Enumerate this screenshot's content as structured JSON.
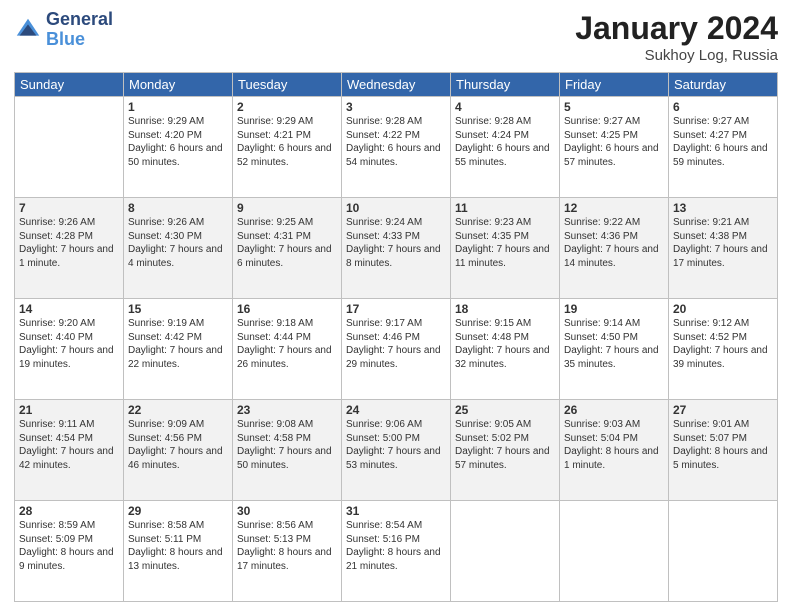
{
  "header": {
    "logo_general": "General",
    "logo_blue": "Blue",
    "month_title": "January 2024",
    "location": "Sukhoy Log, Russia"
  },
  "columns": [
    "Sunday",
    "Monday",
    "Tuesday",
    "Wednesday",
    "Thursday",
    "Friday",
    "Saturday"
  ],
  "weeks": [
    [
      {
        "day": "",
        "sunrise": "",
        "sunset": "",
        "daylight": ""
      },
      {
        "day": "1",
        "sunrise": "Sunrise: 9:29 AM",
        "sunset": "Sunset: 4:20 PM",
        "daylight": "Daylight: 6 hours and 50 minutes."
      },
      {
        "day": "2",
        "sunrise": "Sunrise: 9:29 AM",
        "sunset": "Sunset: 4:21 PM",
        "daylight": "Daylight: 6 hours and 52 minutes."
      },
      {
        "day": "3",
        "sunrise": "Sunrise: 9:28 AM",
        "sunset": "Sunset: 4:22 PM",
        "daylight": "Daylight: 6 hours and 54 minutes."
      },
      {
        "day": "4",
        "sunrise": "Sunrise: 9:28 AM",
        "sunset": "Sunset: 4:24 PM",
        "daylight": "Daylight: 6 hours and 55 minutes."
      },
      {
        "day": "5",
        "sunrise": "Sunrise: 9:27 AM",
        "sunset": "Sunset: 4:25 PM",
        "daylight": "Daylight: 6 hours and 57 minutes."
      },
      {
        "day": "6",
        "sunrise": "Sunrise: 9:27 AM",
        "sunset": "Sunset: 4:27 PM",
        "daylight": "Daylight: 6 hours and 59 minutes."
      }
    ],
    [
      {
        "day": "7",
        "sunrise": "Sunrise: 9:26 AM",
        "sunset": "Sunset: 4:28 PM",
        "daylight": "Daylight: 7 hours and 1 minute."
      },
      {
        "day": "8",
        "sunrise": "Sunrise: 9:26 AM",
        "sunset": "Sunset: 4:30 PM",
        "daylight": "Daylight: 7 hours and 4 minutes."
      },
      {
        "day": "9",
        "sunrise": "Sunrise: 9:25 AM",
        "sunset": "Sunset: 4:31 PM",
        "daylight": "Daylight: 7 hours and 6 minutes."
      },
      {
        "day": "10",
        "sunrise": "Sunrise: 9:24 AM",
        "sunset": "Sunset: 4:33 PM",
        "daylight": "Daylight: 7 hours and 8 minutes."
      },
      {
        "day": "11",
        "sunrise": "Sunrise: 9:23 AM",
        "sunset": "Sunset: 4:35 PM",
        "daylight": "Daylight: 7 hours and 11 minutes."
      },
      {
        "day": "12",
        "sunrise": "Sunrise: 9:22 AM",
        "sunset": "Sunset: 4:36 PM",
        "daylight": "Daylight: 7 hours and 14 minutes."
      },
      {
        "day": "13",
        "sunrise": "Sunrise: 9:21 AM",
        "sunset": "Sunset: 4:38 PM",
        "daylight": "Daylight: 7 hours and 17 minutes."
      }
    ],
    [
      {
        "day": "14",
        "sunrise": "Sunrise: 9:20 AM",
        "sunset": "Sunset: 4:40 PM",
        "daylight": "Daylight: 7 hours and 19 minutes."
      },
      {
        "day": "15",
        "sunrise": "Sunrise: 9:19 AM",
        "sunset": "Sunset: 4:42 PM",
        "daylight": "Daylight: 7 hours and 22 minutes."
      },
      {
        "day": "16",
        "sunrise": "Sunrise: 9:18 AM",
        "sunset": "Sunset: 4:44 PM",
        "daylight": "Daylight: 7 hours and 26 minutes."
      },
      {
        "day": "17",
        "sunrise": "Sunrise: 9:17 AM",
        "sunset": "Sunset: 4:46 PM",
        "daylight": "Daylight: 7 hours and 29 minutes."
      },
      {
        "day": "18",
        "sunrise": "Sunrise: 9:15 AM",
        "sunset": "Sunset: 4:48 PM",
        "daylight": "Daylight: 7 hours and 32 minutes."
      },
      {
        "day": "19",
        "sunrise": "Sunrise: 9:14 AM",
        "sunset": "Sunset: 4:50 PM",
        "daylight": "Daylight: 7 hours and 35 minutes."
      },
      {
        "day": "20",
        "sunrise": "Sunrise: 9:12 AM",
        "sunset": "Sunset: 4:52 PM",
        "daylight": "Daylight: 7 hours and 39 minutes."
      }
    ],
    [
      {
        "day": "21",
        "sunrise": "Sunrise: 9:11 AM",
        "sunset": "Sunset: 4:54 PM",
        "daylight": "Daylight: 7 hours and 42 minutes."
      },
      {
        "day": "22",
        "sunrise": "Sunrise: 9:09 AM",
        "sunset": "Sunset: 4:56 PM",
        "daylight": "Daylight: 7 hours and 46 minutes."
      },
      {
        "day": "23",
        "sunrise": "Sunrise: 9:08 AM",
        "sunset": "Sunset: 4:58 PM",
        "daylight": "Daylight: 7 hours and 50 minutes."
      },
      {
        "day": "24",
        "sunrise": "Sunrise: 9:06 AM",
        "sunset": "Sunset: 5:00 PM",
        "daylight": "Daylight: 7 hours and 53 minutes."
      },
      {
        "day": "25",
        "sunrise": "Sunrise: 9:05 AM",
        "sunset": "Sunset: 5:02 PM",
        "daylight": "Daylight: 7 hours and 57 minutes."
      },
      {
        "day": "26",
        "sunrise": "Sunrise: 9:03 AM",
        "sunset": "Sunset: 5:04 PM",
        "daylight": "Daylight: 8 hours and 1 minute."
      },
      {
        "day": "27",
        "sunrise": "Sunrise: 9:01 AM",
        "sunset": "Sunset: 5:07 PM",
        "daylight": "Daylight: 8 hours and 5 minutes."
      }
    ],
    [
      {
        "day": "28",
        "sunrise": "Sunrise: 8:59 AM",
        "sunset": "Sunset: 5:09 PM",
        "daylight": "Daylight: 8 hours and 9 minutes."
      },
      {
        "day": "29",
        "sunrise": "Sunrise: 8:58 AM",
        "sunset": "Sunset: 5:11 PM",
        "daylight": "Daylight: 8 hours and 13 minutes."
      },
      {
        "day": "30",
        "sunrise": "Sunrise: 8:56 AM",
        "sunset": "Sunset: 5:13 PM",
        "daylight": "Daylight: 8 hours and 17 minutes."
      },
      {
        "day": "31",
        "sunrise": "Sunrise: 8:54 AM",
        "sunset": "Sunset: 5:16 PM",
        "daylight": "Daylight: 8 hours and 21 minutes."
      },
      {
        "day": "",
        "sunrise": "",
        "sunset": "",
        "daylight": ""
      },
      {
        "day": "",
        "sunrise": "",
        "sunset": "",
        "daylight": ""
      },
      {
        "day": "",
        "sunrise": "",
        "sunset": "",
        "daylight": ""
      }
    ]
  ]
}
